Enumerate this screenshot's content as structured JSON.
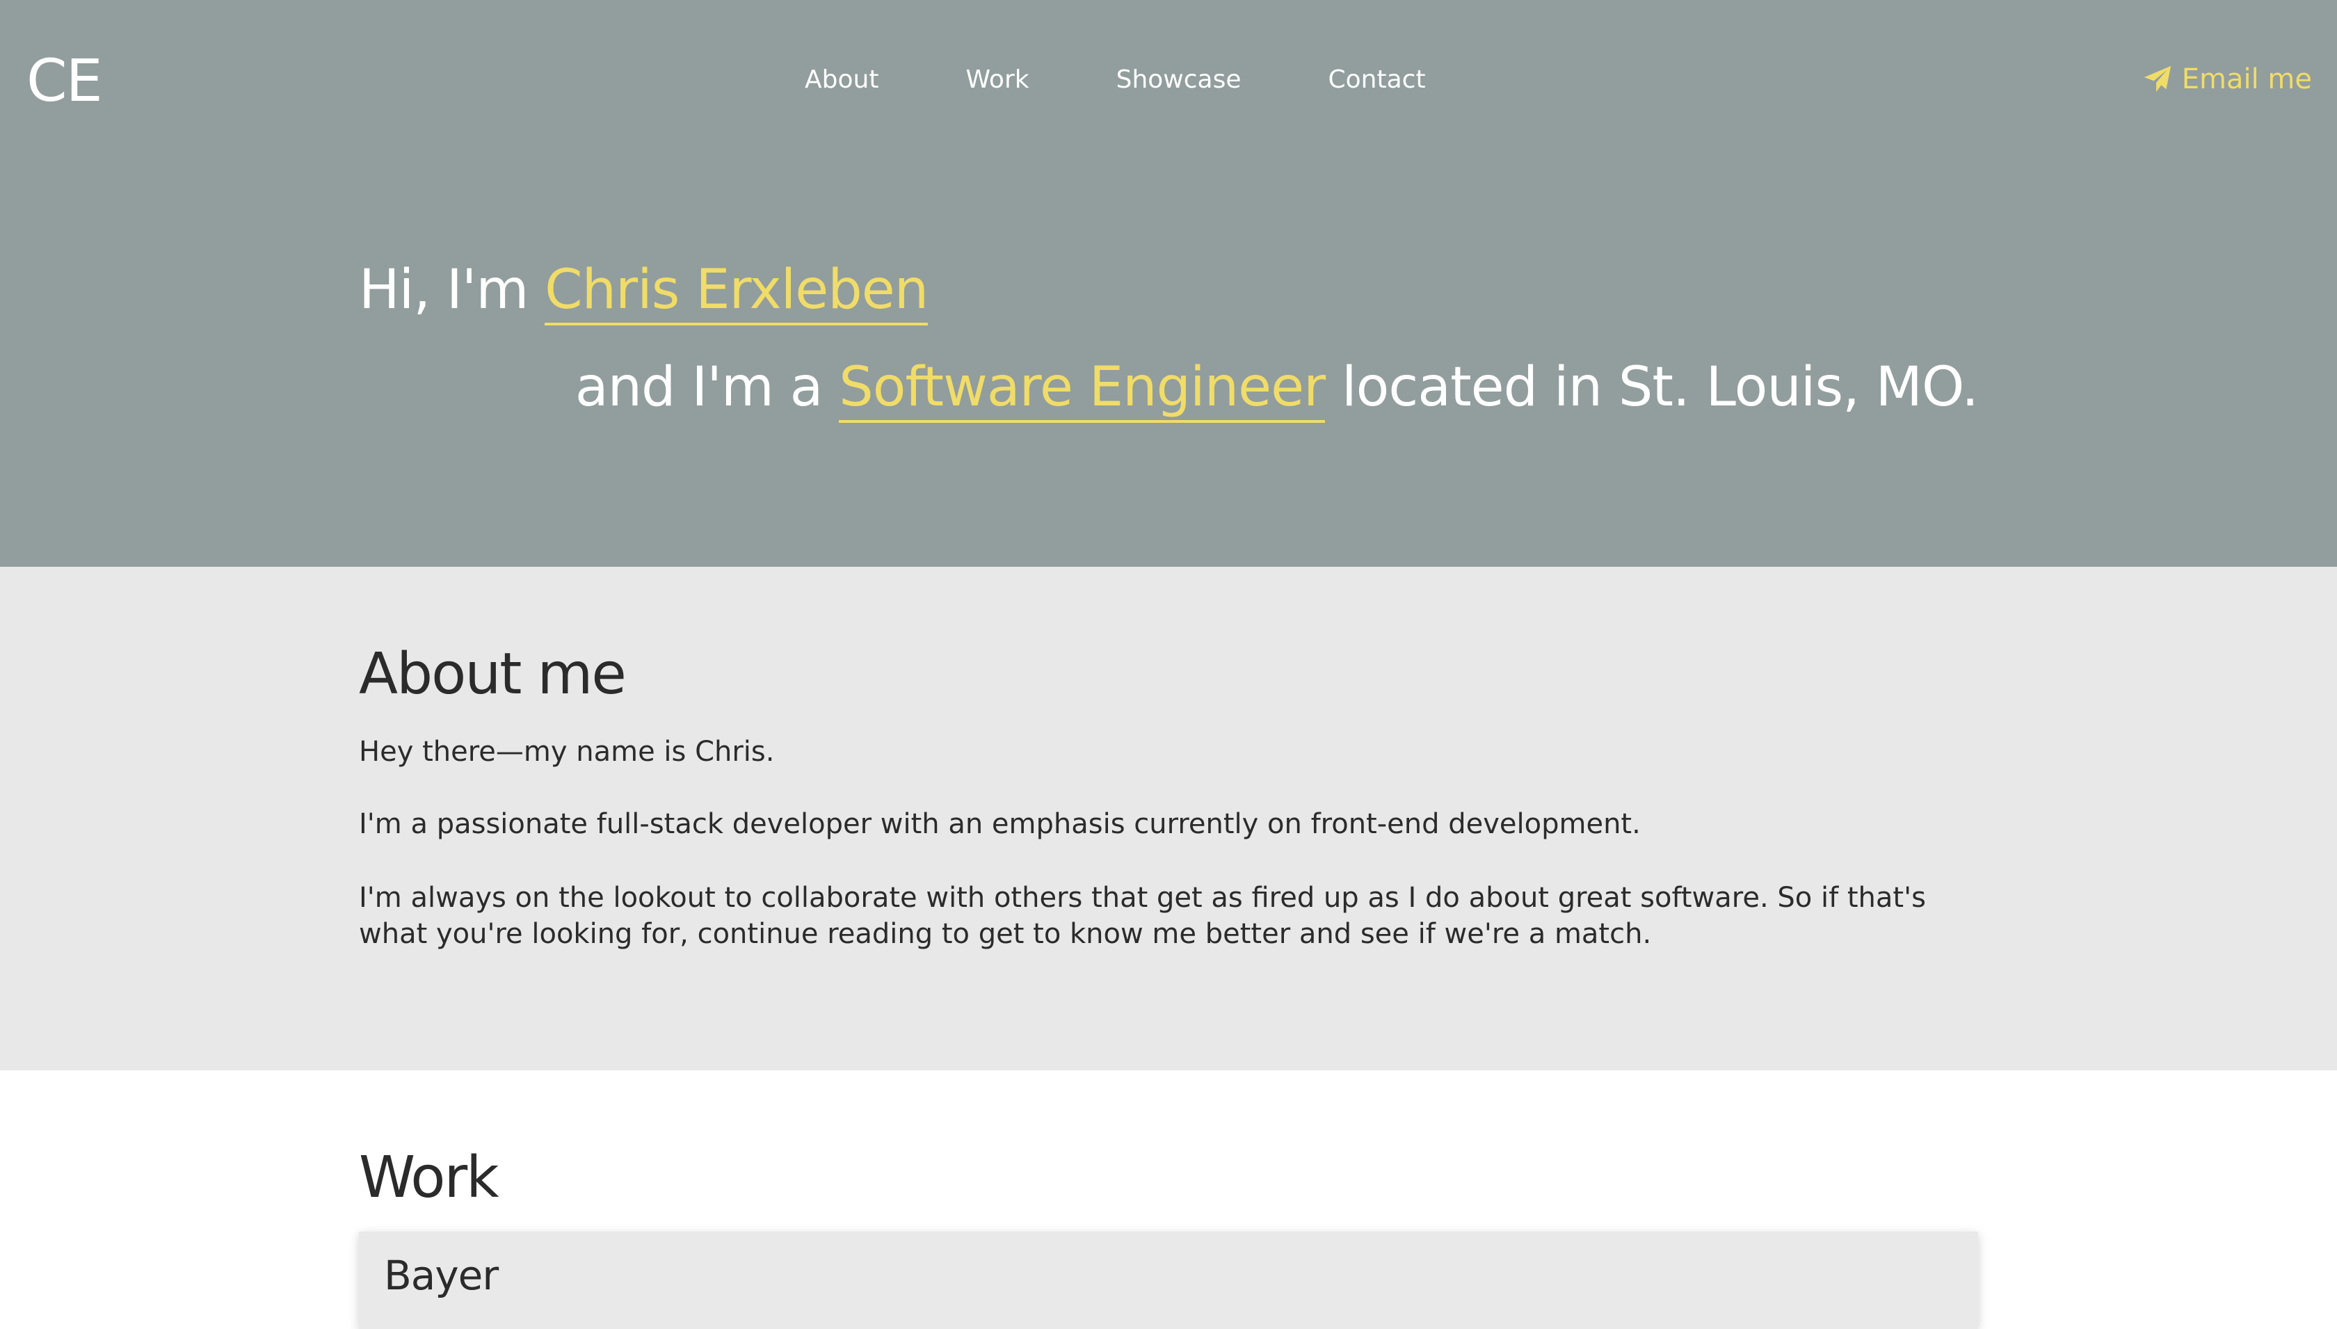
{
  "header": {
    "logo": "CE",
    "nav": [
      "About",
      "Work",
      "Showcase",
      "Contact"
    ],
    "email_label": "Email me",
    "email_icon": "paper-plane-icon",
    "accent_color": "#f0dc68"
  },
  "hero": {
    "greeting_prefix": "Hi, I'm ",
    "name": "Chris Erxleben",
    "role_prefix": "and I'm a ",
    "role": "Software Engineer",
    "role_suffix": " located in St. Louis, MO."
  },
  "about": {
    "title": "About me",
    "paragraphs": [
      "Hey there—my name is Chris.",
      "I'm a passionate full-stack developer with an emphasis currently on front-end development.",
      "I'm always on the lookout to collaborate with others that get as fired up as I do about great software. So if that's what you're looking for, continue reading to get to know me better and see if we're a match."
    ]
  },
  "work": {
    "title": "Work",
    "jobs": [
      {
        "company": "Bayer"
      }
    ]
  }
}
